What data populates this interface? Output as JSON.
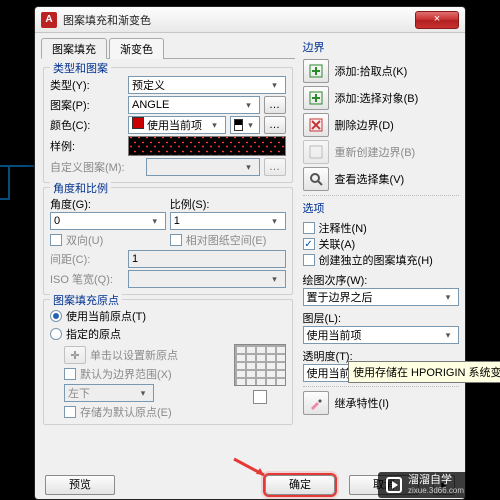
{
  "titlebar": {
    "title": "图案填充和渐变色",
    "app_letter": "A",
    "close_glyph": "×"
  },
  "tabs": {
    "hatch": "图案填充",
    "gradient": "渐变色"
  },
  "type_pat": {
    "title": "类型和图案",
    "type_label": "类型(Y):",
    "type_value": "预定义",
    "pattern_label": "图案(P):",
    "pattern_value": "ANGLE",
    "color_label": "颜色(C):",
    "color_value": "使用当前项",
    "color2_value": "☑",
    "sample_label": "样例:",
    "custom_label": "自定义图案(M):"
  },
  "angle_scale": {
    "title": "角度和比例",
    "angle_label": "角度(G):",
    "angle_value": "0",
    "scale_label": "比例(S):",
    "scale_value": "1",
    "double_label": "双向(U)",
    "relpaper_label": "相对图纸空间(E)",
    "spacing_label": "间距(C):",
    "spacing_value": "1",
    "iso_label": "ISO 笔宽(Q):"
  },
  "origin": {
    "title": "图案填充原点",
    "use_current": "使用当前原点(T)",
    "specified": "指定的原点",
    "click_set": "单击以设置新原点",
    "default_ext": "默认为边界范围(X)",
    "anchor": "左下",
    "store": "存储为默认原点(E)"
  },
  "right": {
    "bounds_title": "边界",
    "add_pick": "添加:拾取点(K)",
    "add_select": "添加:选择对象(B)",
    "remove": "删除边界(D)",
    "rebuild": "重新创建边界(B)",
    "view_sel": "查看选择集(V)",
    "options": "选项",
    "annotative": "注释性(N)",
    "assoc": "关联(A)",
    "create_sep": "创建独立的图案填充(H)",
    "draw_order": "绘图次序(W):",
    "draw_order_value": "置于边界之后",
    "layer": "图层(L):",
    "layer_value": "使用当前项",
    "transparency": "透明度(T):",
    "transparency_value": "使用当前项",
    "inherit": "继承特性(I)"
  },
  "tooltip": "使用存储在 HPORIGIN 系统变量中的图案填充",
  "footer": {
    "preview": "预览",
    "ok": "确定",
    "cancel": "取消",
    "expand_glyph": "▸"
  },
  "watermark": {
    "main": "溜溜自学",
    "sub": "zixue.3d66.com"
  }
}
